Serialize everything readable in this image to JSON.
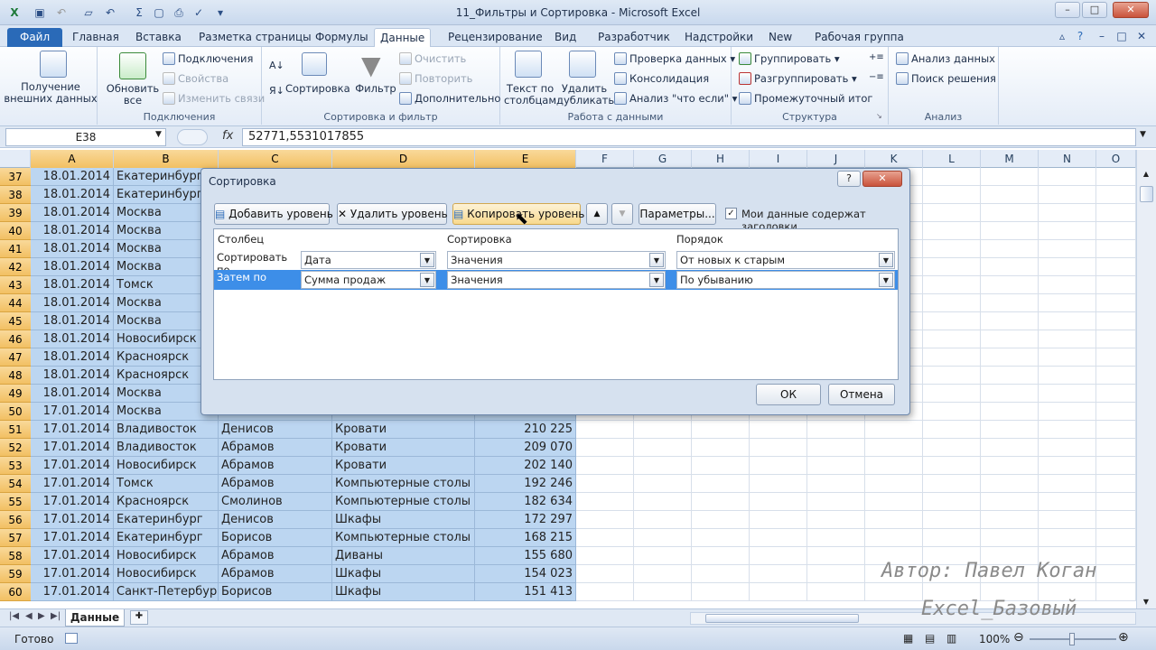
{
  "window": {
    "title": "11_Фильтры и Сортировка - Microsoft Excel",
    "buttons": {
      "minimize": "–",
      "maximize": "□",
      "close": "✕"
    }
  },
  "ribbon_tabs": [
    "Файл",
    "Главная",
    "Вставка",
    "Разметка страницы",
    "Формулы",
    "Данные",
    "Рецензирование",
    "Вид",
    "Разработчик",
    "Надстройки",
    "New",
    "Рабочая группа"
  ],
  "ribbon": {
    "external_data": "Получение внешних данных",
    "refresh_all": "Обновить все",
    "connections": "Подключения",
    "properties": "Свойства",
    "edit_links": "Изменить связи",
    "group_connections": "Подключения",
    "sort": "Сортировка",
    "filter": "Фильтр",
    "clear": "Очистить",
    "reapply": "Повторить",
    "advanced": "Дополнительно",
    "group_sort_filter": "Сортировка и фильтр",
    "text_to_columns": "Текст по столбцам",
    "remove_duplicates": "Удалить дубликаты",
    "data_validation": "Проверка данных",
    "consolidate": "Консолидация",
    "what_if": "Анализ \"что если\"",
    "group_data_tools": "Работа с данными",
    "group": "Группировать",
    "ungroup": "Разгруппировать",
    "subtotal": "Промежуточный итог",
    "group_outline": "Структура",
    "data_analysis": "Анализ данных",
    "solver": "Поиск решения",
    "group_analysis": "Анализ"
  },
  "formula_bar": {
    "name_box": "E38",
    "fx": "fx",
    "value": "52771,5531017855"
  },
  "columns": [
    "A",
    "B",
    "C",
    "D",
    "E",
    "F",
    "G",
    "H",
    "I",
    "J",
    "K",
    "L",
    "M",
    "N",
    "O"
  ],
  "rows": [
    {
      "num": "37",
      "a": "18.01.2014",
      "b": "Екатеринбург",
      "c": "",
      "d": "",
      "e": ""
    },
    {
      "num": "38",
      "a": "18.01.2014",
      "b": "Екатеринбург",
      "c": "",
      "d": "",
      "e": ""
    },
    {
      "num": "39",
      "a": "18.01.2014",
      "b": "Москва",
      "c": "",
      "d": "",
      "e": ""
    },
    {
      "num": "40",
      "a": "18.01.2014",
      "b": "Москва",
      "c": "",
      "d": "",
      "e": ""
    },
    {
      "num": "41",
      "a": "18.01.2014",
      "b": "Москва",
      "c": "",
      "d": "",
      "e": ""
    },
    {
      "num": "42",
      "a": "18.01.2014",
      "b": "Москва",
      "c": "",
      "d": "",
      "e": ""
    },
    {
      "num": "43",
      "a": "18.01.2014",
      "b": "Томск",
      "c": "",
      "d": "",
      "e": ""
    },
    {
      "num": "44",
      "a": "18.01.2014",
      "b": "Москва",
      "c": "",
      "d": "",
      "e": ""
    },
    {
      "num": "45",
      "a": "18.01.2014",
      "b": "Москва",
      "c": "",
      "d": "",
      "e": ""
    },
    {
      "num": "46",
      "a": "18.01.2014",
      "b": "Новосибирск",
      "c": "",
      "d": "",
      "e": ""
    },
    {
      "num": "47",
      "a": "18.01.2014",
      "b": "Красноярск",
      "c": "",
      "d": "",
      "e": ""
    },
    {
      "num": "48",
      "a": "18.01.2014",
      "b": "Красноярск",
      "c": "",
      "d": "",
      "e": ""
    },
    {
      "num": "49",
      "a": "18.01.2014",
      "b": "Москва",
      "c": "",
      "d": "",
      "e": ""
    },
    {
      "num": "50",
      "a": "17.01.2014",
      "b": "Москва",
      "c": "",
      "d": "",
      "e": ""
    },
    {
      "num": "51",
      "a": "17.01.2014",
      "b": "Владивосток",
      "c": "Денисов",
      "d": "Кровати",
      "e": "210 225"
    },
    {
      "num": "52",
      "a": "17.01.2014",
      "b": "Владивосток",
      "c": "Абрамов",
      "d": "Кровати",
      "e": "209 070"
    },
    {
      "num": "53",
      "a": "17.01.2014",
      "b": "Новосибирск",
      "c": "Абрамов",
      "d": "Кровати",
      "e": "202 140"
    },
    {
      "num": "54",
      "a": "17.01.2014",
      "b": "Томск",
      "c": "Абрамов",
      "d": "Компьютерные столы",
      "e": "192 246"
    },
    {
      "num": "55",
      "a": "17.01.2014",
      "b": "Красноярск",
      "c": "Смолинов",
      "d": "Компьютерные столы",
      "e": "182 634"
    },
    {
      "num": "56",
      "a": "17.01.2014",
      "b": "Екатеринбург",
      "c": "Денисов",
      "d": "Шкафы",
      "e": "172 297"
    },
    {
      "num": "57",
      "a": "17.01.2014",
      "b": "Екатеринбург",
      "c": "Борисов",
      "d": "Компьютерные столы",
      "e": "168 215"
    },
    {
      "num": "58",
      "a": "17.01.2014",
      "b": "Новосибирск",
      "c": "Абрамов",
      "d": "Диваны",
      "e": "155 680"
    },
    {
      "num": "59",
      "a": "17.01.2014",
      "b": "Новосибирск",
      "c": "Абрамов",
      "d": "Шкафы",
      "e": "154 023"
    },
    {
      "num": "60",
      "a": "17.01.2014",
      "b": "Санкт-Петербург",
      "c": "Борисов",
      "d": "Шкафы",
      "e": "151 413"
    }
  ],
  "sheet_tab": "Данные",
  "status": {
    "ready": "Готово",
    "zoom": "100%"
  },
  "dialog": {
    "title": "Сортировка",
    "help": "?",
    "close": "✕",
    "add_level": "Добавить уровень",
    "delete_level": "Удалить уровень",
    "copy_level": "Копировать уровень",
    "options": "Параметры...",
    "headers_label": "Мои данные содержат заголовки",
    "col_header": "Столбец",
    "sort_header": "Сортировка",
    "order_header": "Порядок",
    "levels": [
      {
        "label": "Сортировать по",
        "column": "Дата",
        "sort_on": "Значения",
        "order": "От новых к старым"
      },
      {
        "label": "Затем по",
        "column": "Сумма продаж",
        "sort_on": "Значения",
        "order": "По убыванию"
      }
    ],
    "ok": "ОК",
    "cancel": "Отмена"
  },
  "watermark": {
    "author": "Автор: Павел Коган",
    "course": "Excel_Базовый"
  }
}
